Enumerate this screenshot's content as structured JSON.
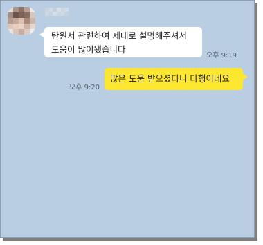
{
  "conversation": {
    "incoming": {
      "lines": [
        "탄원서 관련하여 제대로 설명해주셔서",
        "도움이 많이됐습니다"
      ],
      "time": "오후 9:19"
    },
    "outgoing": {
      "text": "많은 도움 받으셨다니 다행이네요",
      "time": "오후 9:20"
    }
  },
  "colors": {
    "chat_background": "#b9cee2",
    "incoming_bubble": "#ffffff",
    "outgoing_bubble": "#fee82f"
  }
}
